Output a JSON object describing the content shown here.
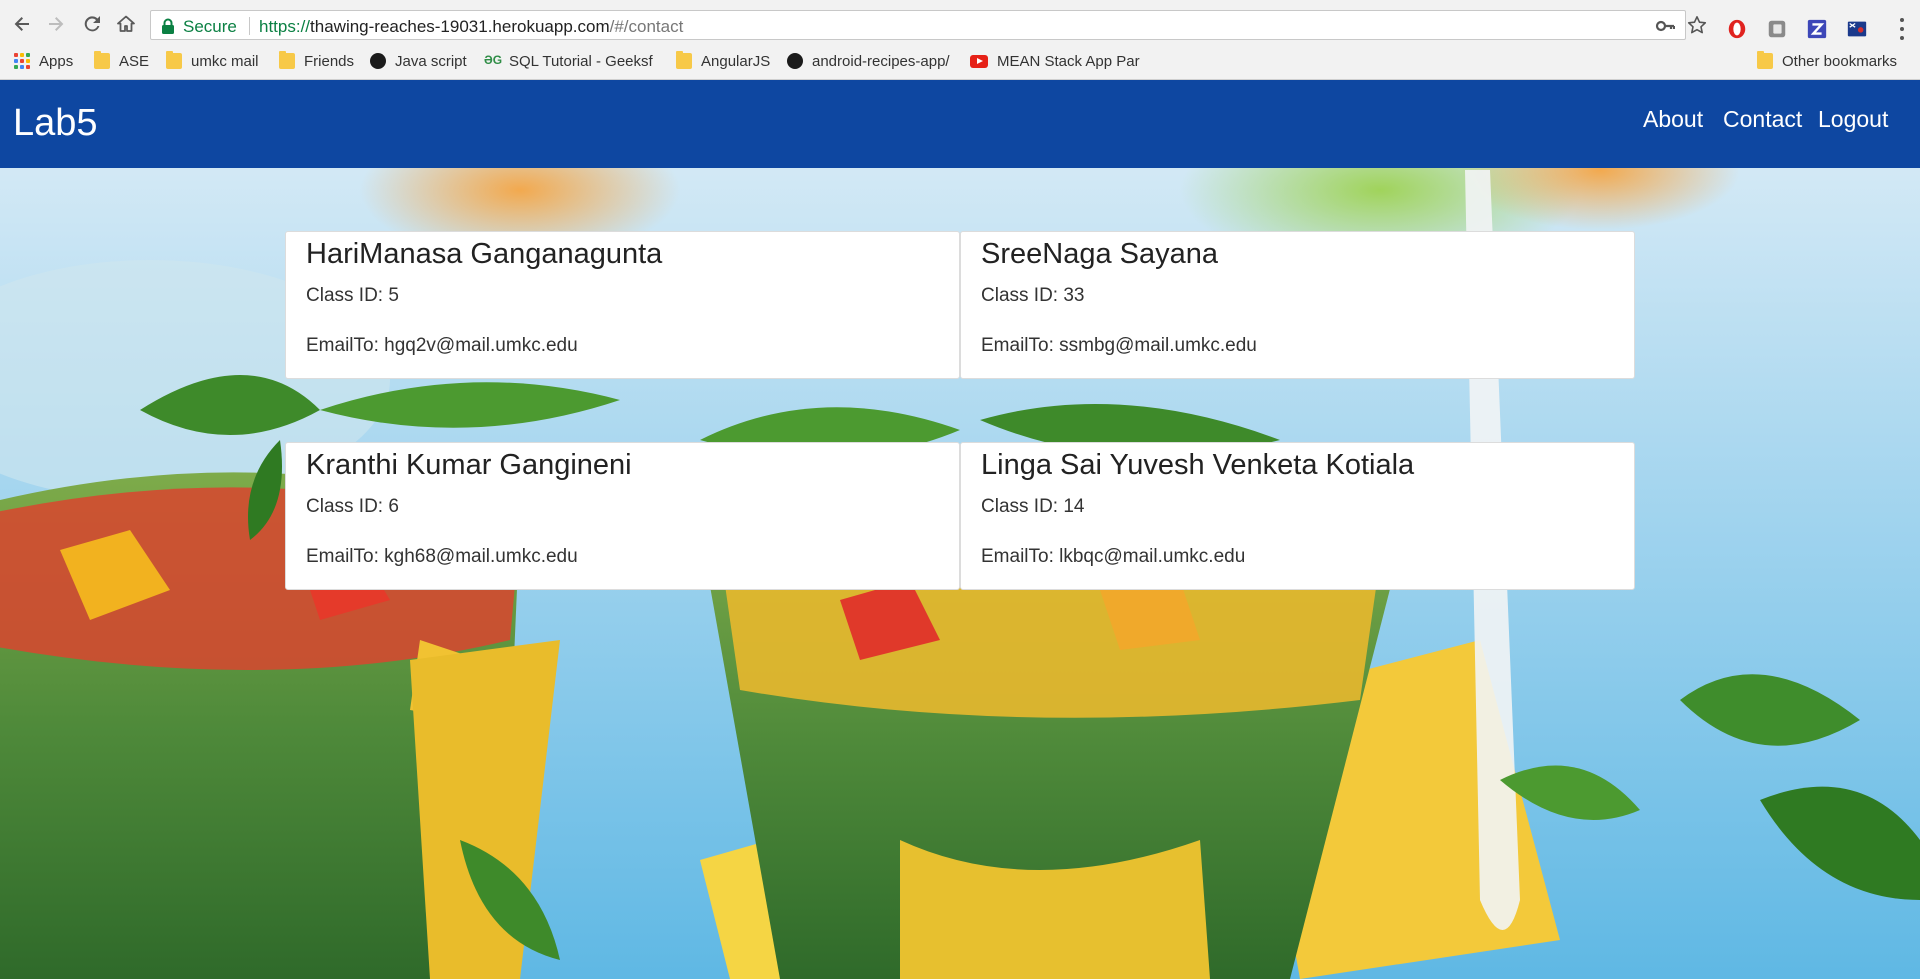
{
  "browser": {
    "secure_label": "Secure",
    "url_scheme": "https://",
    "url_host": "thawing-reaches-19031.herokuapp.com",
    "url_path": "/#/contact"
  },
  "bookmarks": [
    {
      "label": "Apps",
      "icon": "apps-grid-icon"
    },
    {
      "label": "ASE",
      "icon": "folder-icon"
    },
    {
      "label": "umkc mail",
      "icon": "folder-icon"
    },
    {
      "label": "Friends",
      "icon": "folder-icon"
    },
    {
      "label": "Java script",
      "icon": "github-icon"
    },
    {
      "label": "SQL Tutorial - Geeksf",
      "icon": "geeksforgeeks-icon"
    },
    {
      "label": "AngularJS",
      "icon": "folder-icon"
    },
    {
      "label": "android-recipes-app/",
      "icon": "github-icon"
    },
    {
      "label": "MEAN Stack App Par",
      "icon": "youtube-icon"
    },
    {
      "label": "Other bookmarks",
      "icon": "folder-icon"
    }
  ],
  "navbar": {
    "brand": "Lab5",
    "links": [
      "About",
      "Contact",
      "Logout"
    ]
  },
  "contacts": [
    {
      "name": "HariManasa Ganganagunta",
      "class_id": "Class ID: 5",
      "email": "EmailTo: hgq2v@mail.umkc.edu"
    },
    {
      "name": "SreeNaga Sayana",
      "class_id": "Class ID: 33",
      "email": "EmailTo: ssmbg@mail.umkc.edu"
    },
    {
      "name": "Kranthi Kumar Gangineni",
      "class_id": "Class ID: 6",
      "email": "EmailTo: kgh68@mail.umkc.edu"
    },
    {
      "name": "Linga Sai Yuvesh Venketa Kotiala",
      "class_id": "Class ID: 14",
      "email": "EmailTo: lkbqc@mail.umkc.edu"
    }
  ]
}
